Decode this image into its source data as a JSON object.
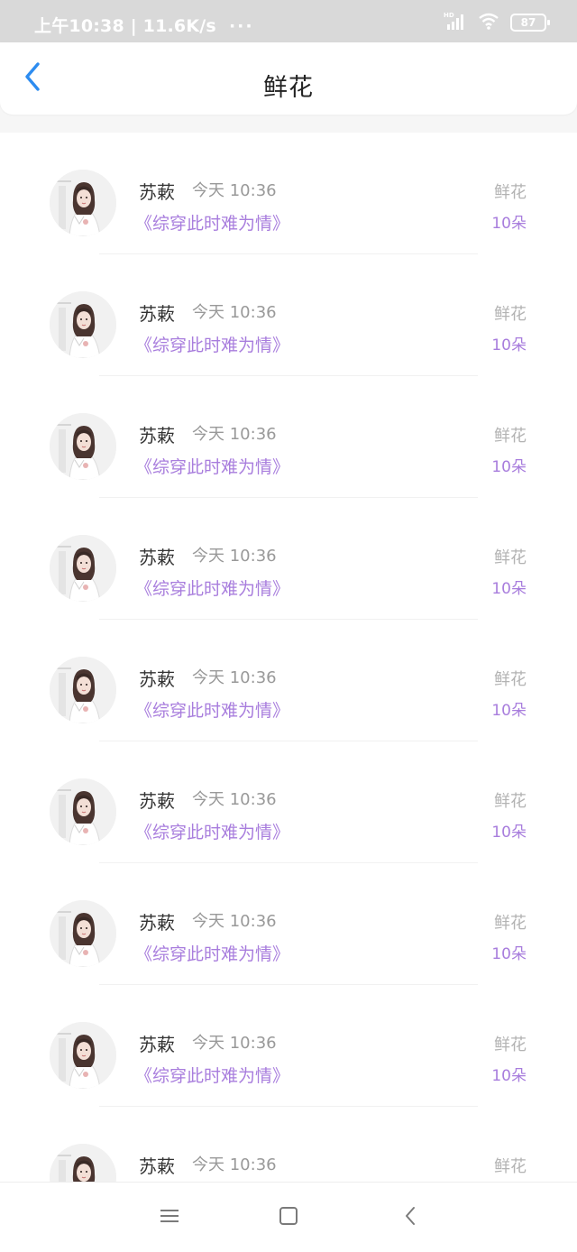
{
  "status_bar": {
    "time": "上午10:38",
    "speed": "11.6K/s",
    "dots": "···",
    "battery": "87",
    "hd_label": "HD"
  },
  "header": {
    "title": "鲜花",
    "back_icon": "chevron-left-icon",
    "accent_color": "#2d8cf0"
  },
  "records": [
    {
      "name": "苏蔌",
      "time": "今天 10:36",
      "book": "《综穿此时难为情》",
      "gift": "鲜花",
      "count": "10朵"
    },
    {
      "name": "苏蔌",
      "time": "今天 10:36",
      "book": "《综穿此时难为情》",
      "gift": "鲜花",
      "count": "10朵"
    },
    {
      "name": "苏蔌",
      "time": "今天 10:36",
      "book": "《综穿此时难为情》",
      "gift": "鲜花",
      "count": "10朵"
    },
    {
      "name": "苏蔌",
      "time": "今天 10:36",
      "book": "《综穿此时难为情》",
      "gift": "鲜花",
      "count": "10朵"
    },
    {
      "name": "苏蔌",
      "time": "今天 10:36",
      "book": "《综穿此时难为情》",
      "gift": "鲜花",
      "count": "10朵"
    },
    {
      "name": "苏蔌",
      "time": "今天 10:36",
      "book": "《综穿此时难为情》",
      "gift": "鲜花",
      "count": "10朵"
    },
    {
      "name": "苏蔌",
      "time": "今天 10:36",
      "book": "《综穿此时难为情》",
      "gift": "鲜花",
      "count": "10朵"
    },
    {
      "name": "苏蔌",
      "time": "今天 10:36",
      "book": "《综穿此时难为情》",
      "gift": "鲜花",
      "count": "10朵"
    },
    {
      "name": "苏蔌",
      "time": "今天 10:36",
      "book": "",
      "gift": "鲜花",
      "count": ""
    }
  ],
  "colors": {
    "accent_purple": "#a87ddd",
    "muted_gray": "#b3b3b3"
  },
  "nav_bar": {
    "menu_icon": "menu-icon",
    "home_icon": "home-square-icon",
    "back_icon": "back-triangle-icon"
  }
}
